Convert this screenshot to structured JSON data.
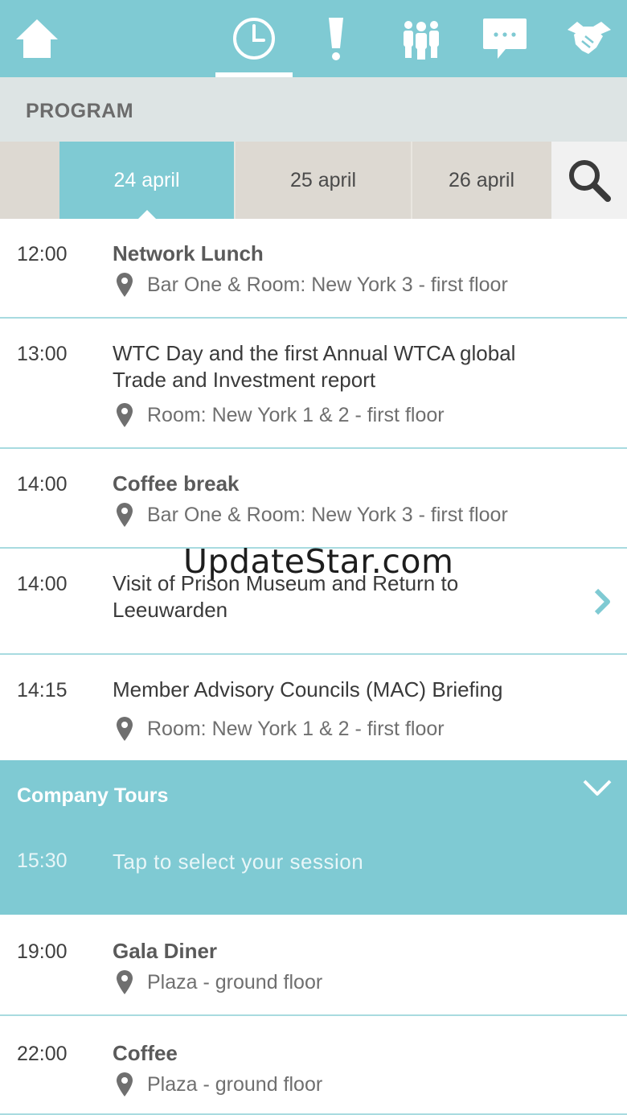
{
  "nav": {
    "home_icon": "home-icon",
    "program_icon": "clock-icon",
    "alert_icon": "exclamation-icon",
    "people_icon": "people-icon",
    "chat_icon": "chat-bubble-icon",
    "deal_icon": "handshake-icon",
    "active": "program"
  },
  "page": {
    "title": "PROGRAM"
  },
  "dates": {
    "tabs": [
      {
        "label": "24 april",
        "active": true
      },
      {
        "label": "25 april",
        "active": false
      },
      {
        "label": "26 april",
        "active": false
      }
    ],
    "search_icon": "search-icon"
  },
  "sessions": [
    {
      "time": "12:00",
      "title": "Network Lunch",
      "location": "Bar One & Room: New York 3 - first floor"
    },
    {
      "time": "13:00",
      "title": "WTC Day and the first Annual WTCA global Trade and Investment report",
      "location": "Room: New York 1 & 2 - first floor"
    },
    {
      "time": "14:00",
      "title": "Coffee break",
      "location": "Bar One & Room: New York 3 - first floor"
    },
    {
      "time": "14:00",
      "title": "Visit of Prison Museum and Return to Leeuwarden"
    },
    {
      "time": "14:15",
      "title": "Member Advisory Councils (MAC) Briefing",
      "location": "Room: New York 1 & 2 - first floor"
    }
  ],
  "group": {
    "title": "Company Tours",
    "time": "15:30",
    "prompt": "Tap to select your session"
  },
  "sessions_after": [
    {
      "time": "19:00",
      "title": "Gala Diner",
      "location": "Plaza - ground floor"
    },
    {
      "time": "22:00",
      "title": "Coffee",
      "location": "Plaza - ground floor"
    }
  ],
  "watermark": "UpdateStar.com",
  "colors": {
    "accent": "#7fcad3",
    "title_band": "#dde4e4",
    "date_bar": "#ddd9d2",
    "divider": "#a8dbe0"
  }
}
